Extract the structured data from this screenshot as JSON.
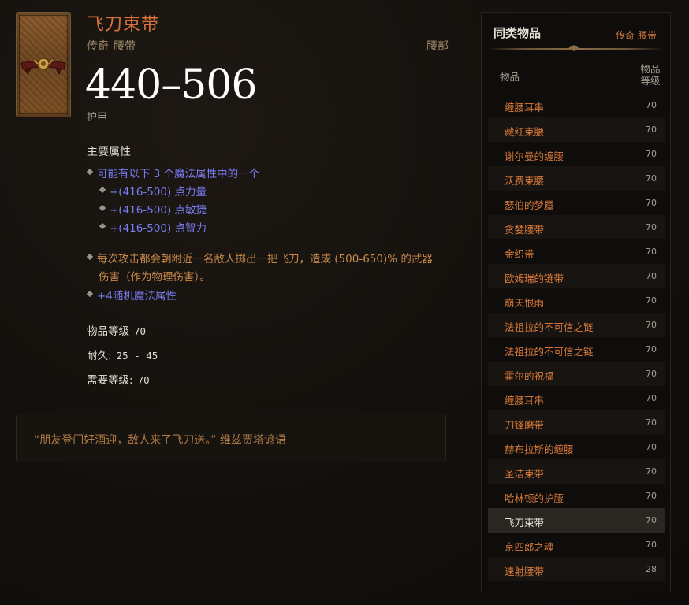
{
  "item": {
    "title": "飞刀束带",
    "rarity": "传奇",
    "category": "腰带",
    "slot": "腰部",
    "armor_value": "440–506",
    "armor_label": "护甲"
  },
  "properties": {
    "section_title": "主要属性",
    "choice_line": "可能有以下 3 个魔法属性中的一个",
    "choices": [
      "+(416-500) 点力量",
      "+(416-500) 点敏捷",
      "+(416-500) 点智力"
    ],
    "legendary_line1": "每次攻击都会朝附近一名敌人掷出一把飞刀，造成 (500-650)% 的武器",
    "legendary_line2": "伤害（作为物理伤害）。",
    "random_line": "+4随机魔法属性"
  },
  "meta": {
    "item_level_label": "物品等级",
    "item_level_value": "70",
    "durability_label": "耐久:",
    "durability_value": "25 - 45",
    "required_level_label": "需要等级:",
    "required_level_value": "70"
  },
  "flavor": "“朋友登门好酒迎，敌人来了飞刀送。” 维兹贾塔谚语",
  "side": {
    "title": "同类物品",
    "filter_rarity": "传奇",
    "filter_category": "腰带",
    "col_item": "物品",
    "col_level_1": "物品",
    "col_level_2": "等级",
    "rows": [
      {
        "name": "缠腰耳串",
        "level": "70"
      },
      {
        "name": "藏红束腰",
        "level": "70"
      },
      {
        "name": "谢尔曼的缠腰",
        "level": "70"
      },
      {
        "name": "沃费束腰",
        "level": "70"
      },
      {
        "name": "瑟伯的梦魇",
        "level": "70"
      },
      {
        "name": "贪婪腰带",
        "level": "70"
      },
      {
        "name": "金织带",
        "level": "70"
      },
      {
        "name": "欧姆瑞的链带",
        "level": "70"
      },
      {
        "name": "崩天恨雨",
        "level": "70"
      },
      {
        "name": "法祖拉的不可信之链",
        "level": "70"
      },
      {
        "name": "法祖拉的不可信之链",
        "level": "70"
      },
      {
        "name": "霍尔的祝福",
        "level": "70"
      },
      {
        "name": "缠腰耳串",
        "level": "70"
      },
      {
        "name": "刀锋磨带",
        "level": "70"
      },
      {
        "name": "赫布拉斯的缠腰",
        "level": "70"
      },
      {
        "name": "圣洁束带",
        "level": "70"
      },
      {
        "name": "哈林顿的护腰",
        "level": "70"
      },
      {
        "name": "飞刀束带",
        "level": "70"
      },
      {
        "name": "京四郎之魂",
        "level": "70"
      },
      {
        "name": "速射腰带",
        "level": "28"
      }
    ],
    "current_index": 17
  }
}
